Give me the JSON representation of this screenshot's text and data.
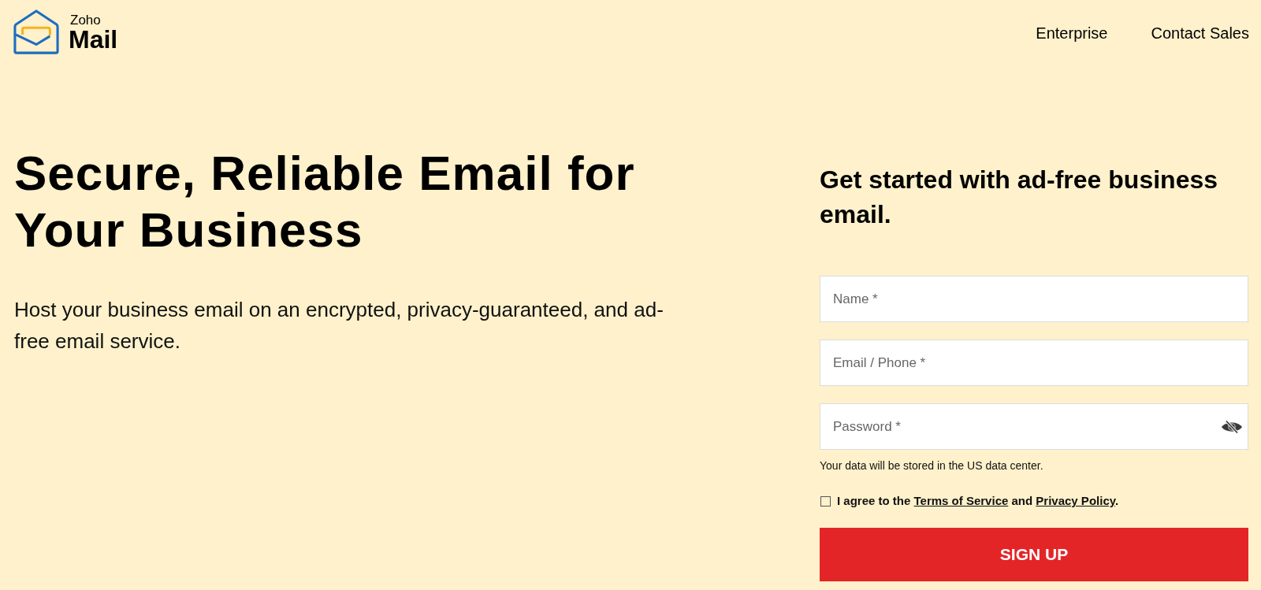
{
  "header": {
    "logo": {
      "brand": "Zoho",
      "product": "Mail"
    },
    "nav": [
      "Enterprise",
      "Contact Sales"
    ]
  },
  "hero": {
    "title": "Secure, Reliable Email for Your Business",
    "description": "Host your business email on an encrypted, privacy-guaranteed, and ad-free email service."
  },
  "signup": {
    "heading": "Get started with ad-free business email.",
    "fields": [
      {
        "kind": "text",
        "placeholder": "Name *"
      },
      {
        "kind": "text",
        "placeholder": "Email / Phone *"
      },
      {
        "kind": "password",
        "placeholder": "Password *",
        "revealed": false
      }
    ],
    "note": "Your data will be stored in the US data center.",
    "consent": {
      "checked": false,
      "segments": [
        {
          "kind": "text",
          "text": "I agree to the "
        },
        {
          "kind": "link",
          "text": "Terms of Service"
        },
        {
          "kind": "text",
          "text": " and "
        },
        {
          "kind": "link",
          "text": "Privacy Policy"
        },
        {
          "kind": "text",
          "text": "."
        }
      ]
    },
    "button": "SIGN UP"
  }
}
